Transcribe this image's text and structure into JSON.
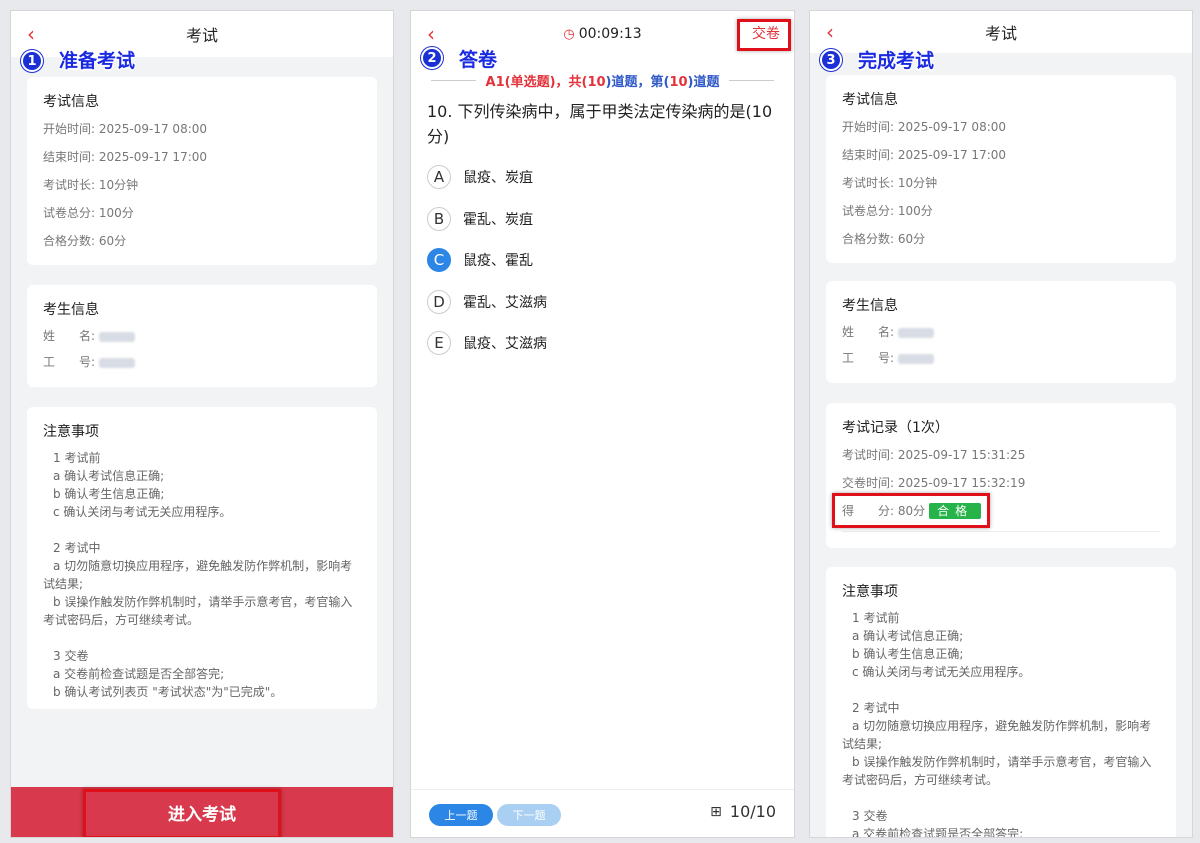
{
  "panel1": {
    "title": "考试",
    "badge": "1",
    "step": "准备考试",
    "exam_info": {
      "heading": "考试信息",
      "rows": [
        {
          "label": "开始时间:",
          "value": "2025-09-17 08:00"
        },
        {
          "label": "结束时间:",
          "value": "2025-09-17 17:00"
        },
        {
          "label": "考试时长:",
          "value": "10分钟"
        },
        {
          "label": "试卷总分:",
          "value": "100分"
        },
        {
          "label": "合格分数:",
          "value": "60分"
        }
      ]
    },
    "candidate": {
      "heading": "考生信息",
      "name_label": "姓　　名:",
      "id_label": "工　　号:"
    },
    "notes": {
      "heading": "注意事项",
      "s1": "1 考试前",
      "s1a": "a 确认考试信息正确;",
      "s1b": "b 确认考生信息正确;",
      "s1c": "c 确认关闭与考试无关应用程序。",
      "s2": "2 考试中",
      "s2a": "a 切勿随意切换应用程序，避免触发防作弊机制，影响考试结果;",
      "s2b": "b 误操作触发防作弊机制时，请举手示意考官，考官输入考试密码后，方可继续考试。",
      "s3": "3 交卷",
      "s3a": "a 交卷前检查试题是否全部答完;",
      "s3b": "b 确认考试列表页 \"考试状态\"为\"已完成\"。"
    },
    "enter_button": "进入考试"
  },
  "panel2": {
    "badge": "2",
    "step": "答卷",
    "timer": "00:09:13",
    "submit": "交卷",
    "meta_pre": "A1(单选题)，共(",
    "meta_total": "10",
    "meta_mid": ")道题，第(",
    "meta_cur": "10",
    "meta_post": ")道题",
    "question": "10. 下列传染病中，属于甲类法定传染病的是(10分)",
    "options": [
      {
        "key": "A",
        "text": "鼠疫、炭疽"
      },
      {
        "key": "B",
        "text": "霍乱、炭疽"
      },
      {
        "key": "C",
        "text": "鼠疫、霍乱"
      },
      {
        "key": "D",
        "text": "霍乱、艾滋病"
      },
      {
        "key": "E",
        "text": "鼠疫、艾滋病"
      }
    ],
    "prev": "上一题",
    "next": "下一题",
    "pager": "10/10"
  },
  "panel3": {
    "title": "考试",
    "badge": "3",
    "step": "完成考试",
    "exam_info": {
      "heading": "考试信息",
      "rows": [
        {
          "label": "开始时间:",
          "value": "2025-09-17 08:00"
        },
        {
          "label": "结束时间:",
          "value": "2025-09-17 17:00"
        },
        {
          "label": "考试时长:",
          "value": "10分钟"
        },
        {
          "label": "试卷总分:",
          "value": "100分"
        },
        {
          "label": "合格分数:",
          "value": "60分"
        }
      ]
    },
    "candidate": {
      "heading": "考生信息",
      "name_label": "姓　　名:",
      "id_label": "工　　号:"
    },
    "record": {
      "heading": "考试记录（1次）",
      "exam_time_label": "考试时间:",
      "exam_time": "2025-09-17 15:31:25",
      "submit_time_label": "交卷时间:",
      "submit_time": "2025-09-17 15:32:19",
      "score_label": "得　　分:",
      "score": "80分",
      "pass": "合格"
    },
    "notes": {
      "heading": "注意事项",
      "s1": "1 考试前",
      "s1a": "a 确认考试信息正确;",
      "s1b": "b 确认考生信息正确;",
      "s1c": "c 确认关闭与考试无关应用程序。",
      "s2": "2 考试中",
      "s2a": "a 切勿随意切换应用程序，避免触发防作弊机制，影响考试结果;",
      "s2b": "b 误操作触发防作弊机制时，请举手示意考官，考官输入考试密码后，方可继续考试。",
      "s3": "3 交卷",
      "s3a": "a 交卷前检查试题是否全部答完;"
    }
  }
}
